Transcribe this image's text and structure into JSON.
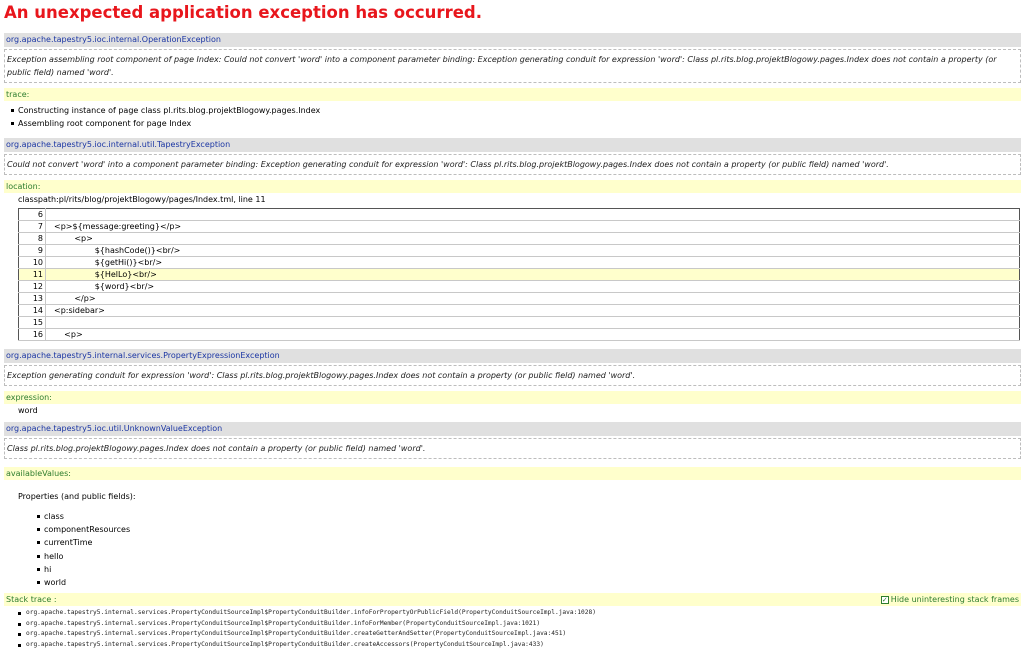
{
  "page": {
    "title": "An unexpected application exception has occurred."
  },
  "exceptions": [
    {
      "class": "org.apache.tapestry5.ioc.internal.OperationException",
      "message": "Exception assembling root component of page Index: Could not convert 'word' into a component parameter binding: Exception generating conduit for expression 'word': Class pl.rits.blog.projektBlogowy.pages.Index does not contain a property (or public field) named 'word'."
    },
    {
      "class": "org.apache.tapestry5.ioc.internal.util.TapestryException",
      "message": "Could not convert 'word' into a component parameter binding: Exception generating conduit for expression 'word': Class pl.rits.blog.projektBlogowy.pages.Index does not contain a property (or public field) named 'word'."
    },
    {
      "class": "org.apache.tapestry5.internal.services.PropertyExpressionException",
      "message": "Exception generating conduit for expression 'word': Class pl.rits.blog.projektBlogowy.pages.Index does not contain a property (or public field) named 'word'."
    },
    {
      "class": "org.apache.tapestry5.ioc.util.UnknownValueException",
      "message": "Class pl.rits.blog.projektBlogowy.pages.Index does not contain a property (or public field) named 'word'."
    }
  ],
  "trace": {
    "label": "trace:",
    "items": [
      "Constructing instance of page class pl.rits.blog.projektBlogowy.pages.Index",
      "Assembling root component for page Index"
    ]
  },
  "location": {
    "label": "location:",
    "file": "classpath:pl/rits/blog/projektBlogowy/pages/Index.tml, line 11",
    "lines": [
      {
        "num": "6",
        "code": ""
      },
      {
        "num": "7",
        "code": "<p>${message:greeting}</p>"
      },
      {
        "num": "8",
        "code": "        <p>"
      },
      {
        "num": "9",
        "code": "                ${hashCode()}<br/>"
      },
      {
        "num": "10",
        "code": "                ${getHi()}<br/>"
      },
      {
        "num": "11",
        "code": "                ${HelLo}<br/>"
      },
      {
        "num": "12",
        "code": "                ${word}<br/>"
      },
      {
        "num": "13",
        "code": "        </p>"
      },
      {
        "num": "14",
        "code": "<p:sidebar>"
      },
      {
        "num": "15",
        "code": ""
      },
      {
        "num": "16",
        "code": "    <p>"
      }
    ],
    "highlight_line": "11"
  },
  "expression": {
    "label": "expression:",
    "value": "word"
  },
  "available_values": {
    "label": "availableValues:",
    "heading": "Properties (and public fields):",
    "items": [
      "class",
      "componentResources",
      "currentTime",
      "hello",
      "hi",
      "world"
    ]
  },
  "stack_trace": {
    "label": "Stack trace :",
    "toggle_label": "Hide uninteresting stack frames",
    "toggle_checked": true,
    "frames": [
      "org.apache.tapestry5.internal.services.PropertyConduitSourceImpl$PropertyConduitBuilder.infoForPropertyOrPublicField(PropertyConduitSourceImpl.java:1028)",
      "org.apache.tapestry5.internal.services.PropertyConduitSourceImpl$PropertyConduitBuilder.infoForMember(PropertyConduitSourceImpl.java:1021)",
      "org.apache.tapestry5.internal.services.PropertyConduitSourceImpl$PropertyConduitBuilder.createGetterAndSetter(PropertyConduitSourceImpl.java:451)",
      "org.apache.tapestry5.internal.services.PropertyConduitSourceImpl$PropertyConduitBuilder.createAccessors(PropertyConduitSourceImpl.java:433)"
    ]
  },
  "colors": {
    "title": "#e8161c",
    "exception_header_bg": "#e0e0e0",
    "exception_header_text": "#1a35a3",
    "property_label_bg": "#ffffcc",
    "property_label_text": "#2e7d2e"
  }
}
